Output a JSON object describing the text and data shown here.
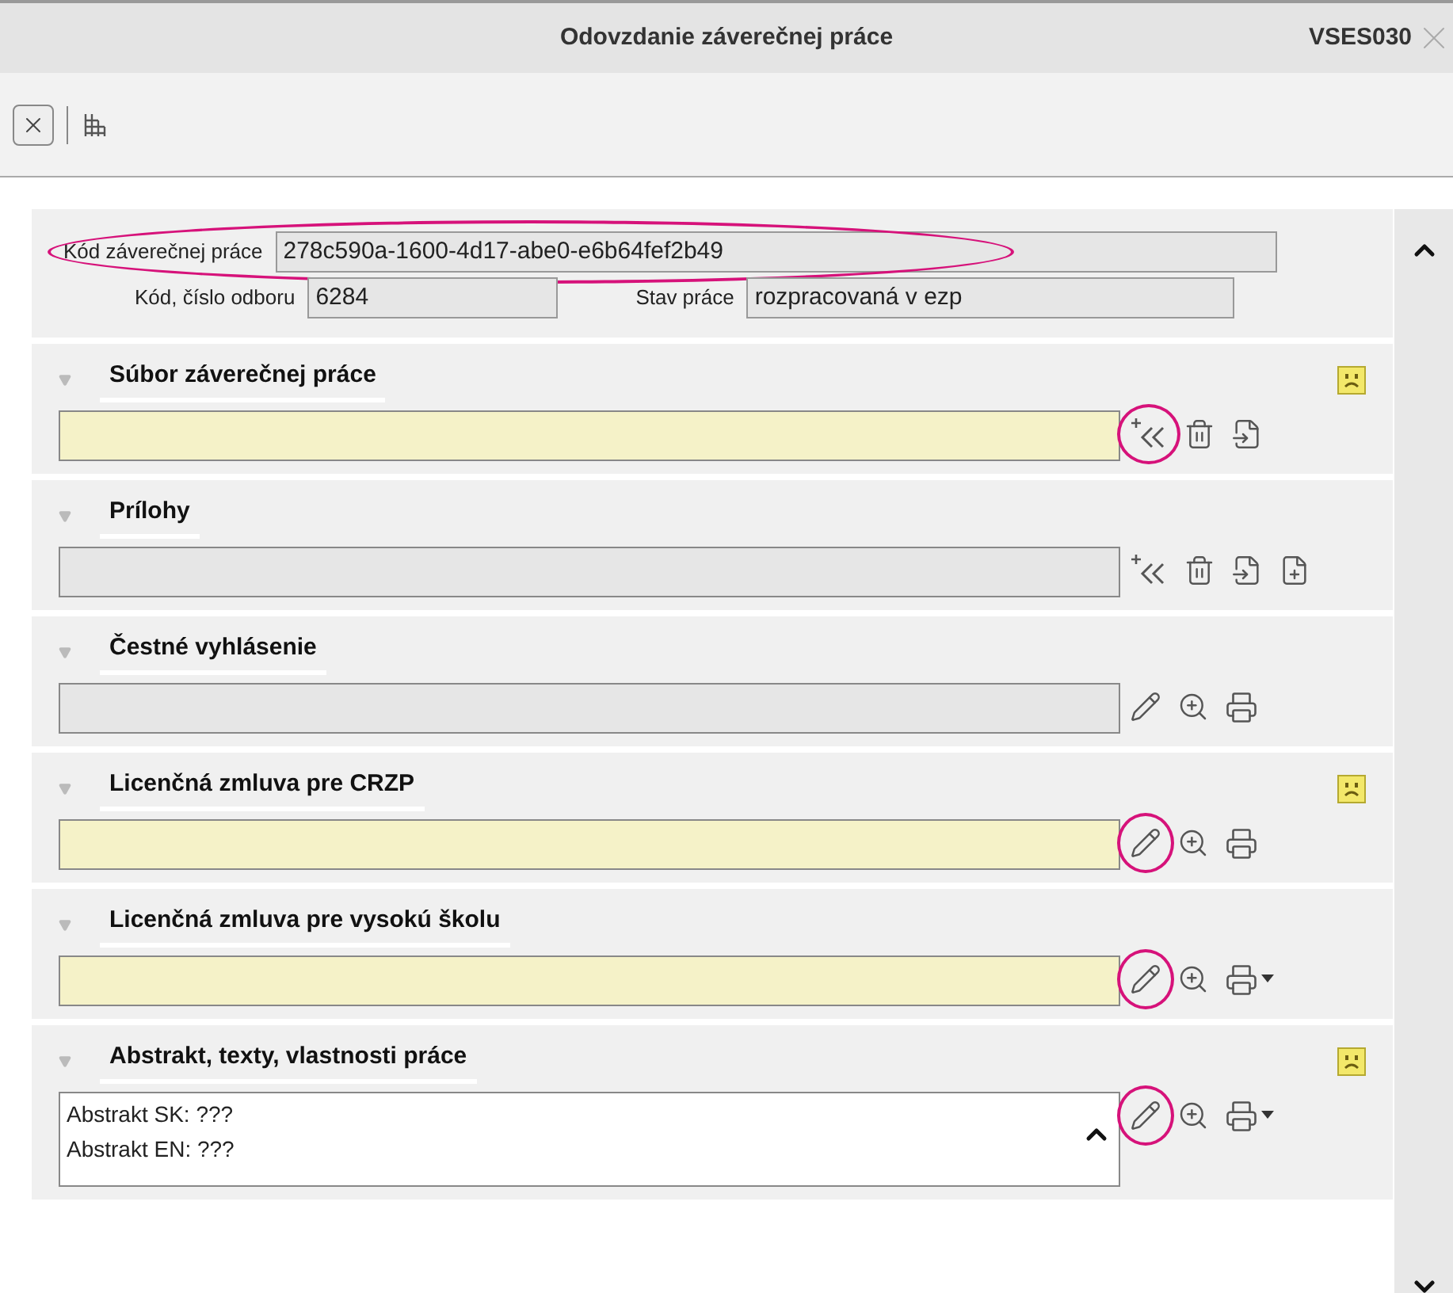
{
  "window": {
    "title": "Odovzdanie záverečnej práce",
    "code": "VSES030"
  },
  "header_fields": [
    {
      "label": "Kód záverečnej práce",
      "value": "278c590a-1600-4d17-abe0-e6b64fef2b49",
      "circled": true,
      "wide": true
    },
    {
      "label": "Kód, číslo odboru",
      "value": "6284",
      "circled": false,
      "wide": false
    },
    {
      "label": "Stav práce",
      "value": "rozpracovaná v ezp",
      "circled": false,
      "wide": false
    }
  ],
  "sections": [
    {
      "title": "Súbor záverečnej práce",
      "warning": true,
      "required": true,
      "actions": [
        {
          "kind": "add",
          "circled": true,
          "dropdown": false
        },
        {
          "kind": "delete",
          "circled": false,
          "dropdown": false
        },
        {
          "kind": "import",
          "circled": false,
          "dropdown": false
        }
      ]
    },
    {
      "title": "Prílohy",
      "warning": false,
      "required": false,
      "actions": [
        {
          "kind": "add",
          "circled": false,
          "dropdown": false
        },
        {
          "kind": "delete",
          "circled": false,
          "dropdown": false
        },
        {
          "kind": "import",
          "circled": false,
          "dropdown": false
        },
        {
          "kind": "new",
          "circled": false,
          "dropdown": false
        }
      ]
    },
    {
      "title": "Čestné vyhlásenie",
      "warning": false,
      "required": false,
      "actions": [
        {
          "kind": "edit",
          "circled": false,
          "dropdown": false
        },
        {
          "kind": "zoom",
          "circled": false,
          "dropdown": false
        },
        {
          "kind": "print",
          "circled": false,
          "dropdown": false
        }
      ]
    },
    {
      "title": "Licenčná zmluva pre CRZP",
      "warning": true,
      "required": true,
      "actions": [
        {
          "kind": "edit",
          "circled": true,
          "dropdown": false
        },
        {
          "kind": "zoom",
          "circled": false,
          "dropdown": false
        },
        {
          "kind": "print",
          "circled": false,
          "dropdown": false
        }
      ]
    },
    {
      "title": "Licenčná zmluva pre vysokú školu",
      "warning": false,
      "required": true,
      "actions": [
        {
          "kind": "edit",
          "circled": true,
          "dropdown": false
        },
        {
          "kind": "zoom",
          "circled": false,
          "dropdown": false
        },
        {
          "kind": "print",
          "circled": false,
          "dropdown": true
        }
      ]
    },
    {
      "title": "Abstrakt, texty, vlastnosti práce",
      "warning": true,
      "required": false,
      "lines": [
        "Abstrakt SK: ???",
        "Abstrakt EN: ???"
      ],
      "actions": [
        {
          "kind": "edit",
          "circled": true,
          "dropdown": false
        },
        {
          "kind": "zoom",
          "circled": false,
          "dropdown": false
        },
        {
          "kind": "print",
          "circled": false,
          "dropdown": true
        }
      ]
    }
  ]
}
